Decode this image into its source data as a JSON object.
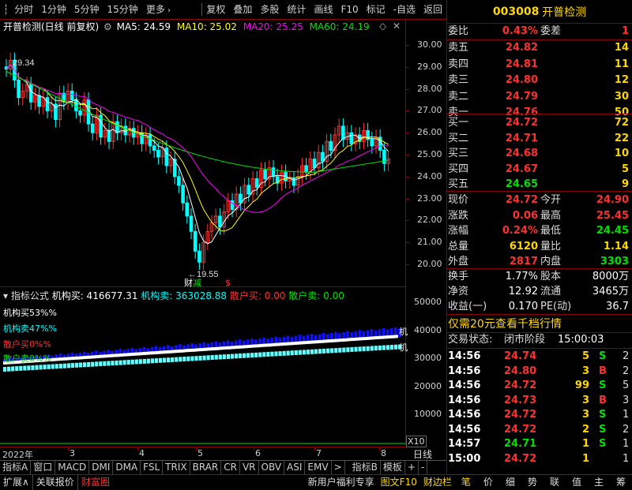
{
  "toolbar": {
    "left": [
      "分时",
      "1分钟",
      "5分钟",
      "15分钟",
      "更多"
    ],
    "right": [
      "复权",
      "叠加",
      "多股",
      "统计",
      "画线",
      "F10",
      "标记",
      "-自选",
      "返回"
    ]
  },
  "chart": {
    "title": "开普检测(日线 前复权)",
    "ma5": "MA5: 24.59",
    "ma10": "MA10: 25.02",
    "ma20": "MA20: 25.25",
    "ma60": "MA60: 24.19",
    "high_label": "29.34",
    "low_label": "19.55",
    "low_marks": [
      "财",
      "减",
      "$"
    ],
    "y_ticks": [
      "30.00",
      "29.00",
      "28.00",
      "27.00",
      "26.00",
      "25.00",
      "24.00",
      "23.00",
      "22.00",
      "21.00",
      "20.00"
    ],
    "colors": {
      "ma5": "#ffffff",
      "ma10": "#ffff00",
      "ma20": "#ff00ff",
      "ma60": "#00e000",
      "up": "#ff3030",
      "down": "#00ffff"
    }
  },
  "indicator": {
    "header": [
      "指标公式",
      "机构买: 416677.31",
      "机构卖: 363028.88",
      "散户买: 0.00",
      "散户卖: 0.00"
    ],
    "legend": [
      "机构买53%%",
      "机构卖47%%",
      "散户买0%%",
      "散户卖0%%"
    ],
    "y_ticks": [
      "50000",
      "40000",
      "30000",
      "20000",
      "10000"
    ],
    "scale": "X10",
    "right_marks": [
      "机",
      "机"
    ]
  },
  "xaxis": {
    "labels": [
      "2022年",
      "3",
      "4",
      "5",
      "6",
      "7",
      "8"
    ],
    "period": "日线"
  },
  "bottom_tabs": [
    "指标A",
    "窗口",
    "MACD",
    "DMI",
    "DMA",
    "FSL",
    "TRIX",
    "BRAR",
    "CR",
    "VR",
    "OBV",
    "ASI",
    "EMV",
    ">",
    "指标B",
    "模板",
    "+",
    "-"
  ],
  "status": {
    "left": [
      "扩展∧",
      "关联报价",
      "财富圈"
    ],
    "right": [
      "新用户福利专享",
      "图文F10",
      "财边栏"
    ],
    "icons": [
      "笔",
      "价",
      "细",
      "势",
      "联",
      "值",
      "主",
      "筹"
    ]
  },
  "quote": {
    "code": "003008",
    "name": "开普检测",
    "weibi": {
      "label": "委比",
      "value": "0.43%",
      "label2": "委差",
      "value2": "1"
    },
    "sell": [
      {
        "label": "卖五",
        "price": "24.82",
        "vol": "14"
      },
      {
        "label": "卖四",
        "price": "24.81",
        "vol": "11"
      },
      {
        "label": "卖三",
        "price": "24.80",
        "vol": "12"
      },
      {
        "label": "卖二",
        "price": "24.79",
        "vol": "30"
      },
      {
        "label": "卖一",
        "price": "24.76",
        "vol": "50"
      }
    ],
    "buy": [
      {
        "label": "买一",
        "price": "24.72",
        "vol": "72"
      },
      {
        "label": "买二",
        "price": "24.71",
        "vol": "22"
      },
      {
        "label": "买三",
        "price": "24.68",
        "vol": "10"
      },
      {
        "label": "买四",
        "price": "24.67",
        "vol": "5"
      },
      {
        "label": "买五",
        "price": "24.65",
        "vol": "9"
      }
    ],
    "stats": [
      {
        "l1": "现价",
        "v1": "24.72",
        "l2": "今开",
        "v2": "24.90"
      },
      {
        "l1": "涨跌",
        "v1": "0.06",
        "l2": "最高",
        "v2": "25.45"
      },
      {
        "l1": "涨幅",
        "v1": "0.24%",
        "l2": "最低",
        "v2": "24.45"
      },
      {
        "l1": "总量",
        "v1": "6120",
        "l2": "量比",
        "v2": "1.14"
      },
      {
        "l1": "外盘",
        "v1": "2817",
        "l2": "内盘",
        "v2": "3303"
      }
    ],
    "stats2": [
      {
        "l1": "换手",
        "v1": "1.77%",
        "l2": "股本",
        "v2": "8000万"
      },
      {
        "l1": "净资",
        "v1": "12.92",
        "l2": "流通",
        "v2": "3465万"
      },
      {
        "l1": "收益(一)",
        "v1": "0.170",
        "l2": "PE(动)",
        "v2": "36.7"
      }
    ],
    "promo": "仅需20元查看千档行情",
    "trade_state_label": "交易状态:",
    "trade_state": "闭市阶段",
    "trade_time": "15:00:03",
    "ticks": [
      {
        "t": "14:56",
        "p": "24.74",
        "v": "5",
        "bs": "S",
        "n": "2"
      },
      {
        "t": "14:56",
        "p": "24.80",
        "v": "3",
        "bs": "B",
        "n": "2"
      },
      {
        "t": "14:56",
        "p": "24.72",
        "v": "99",
        "bs": "S",
        "n": "5"
      },
      {
        "t": "14:56",
        "p": "24.73",
        "v": "3",
        "bs": "B",
        "n": "3"
      },
      {
        "t": "14:56",
        "p": "24.72",
        "v": "3",
        "bs": "S",
        "n": "1"
      },
      {
        "t": "14:56",
        "p": "24.72",
        "v": "2",
        "bs": "S",
        "n": "2"
      },
      {
        "t": "14:57",
        "p": "24.71",
        "v": "1",
        "bs": "S",
        "n": "1"
      },
      {
        "t": "15:00",
        "p": "24.72",
        "v": "1",
        "bs": "",
        "n": "1"
      }
    ]
  }
}
